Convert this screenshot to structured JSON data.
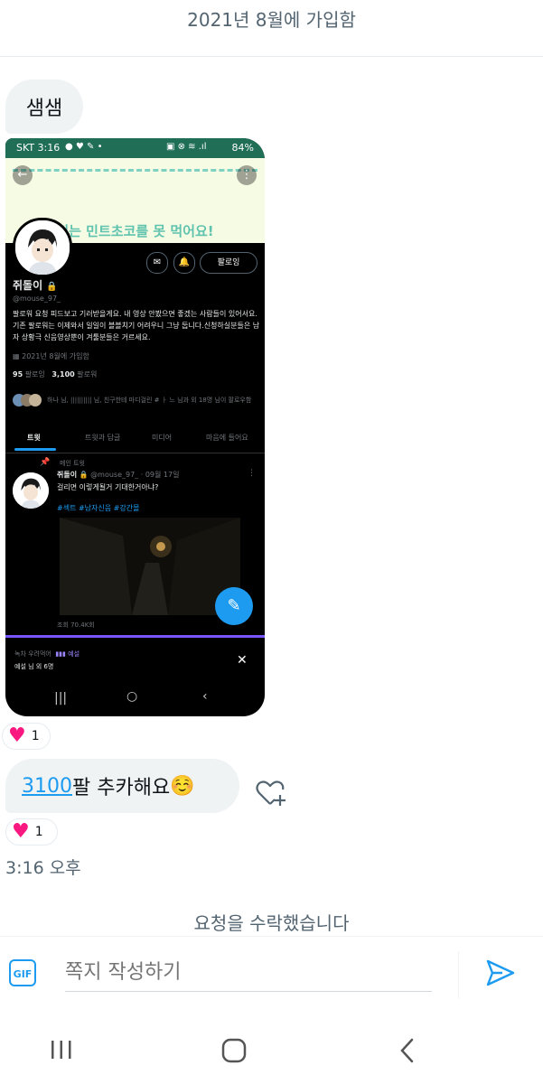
{
  "conversation": {
    "joined_text": "2021년 8월에 가입함",
    "message1": "샘샘",
    "message2_link": "3100",
    "message2_rest": "팔 추카해요",
    "message2_emoji": "☺️",
    "reaction1_count": "1",
    "reaction2_count": "1",
    "timestamp": "3:16 오후",
    "accepted_text": "요청을 수락했습니다"
  },
  "composer": {
    "gif_label": "GIF",
    "placeholder": "쪽지 작성하기"
  },
  "screenshot": {
    "status_time": "SKT 3:16",
    "status_battery": "84%",
    "banner_text": "저는 민트초코를 못 먹어요!",
    "follow_button": "팔로잉",
    "name": "쥐돌이",
    "handle": "@mouse_97_",
    "bio": "팔로워 요청 피드보고 기러받을게요. 내 영상 안봤으면 좋겠는 사람들이 있어서요. 기존 팔로워는 이제와서 일일이 블블치기 어려우니 그냥 둡니다.신청하실분들은 남자 상황극 신음영상뿐이 겨툴분들은 거르세요.",
    "joined": "2021년 8월에 가입함",
    "following_count": "95",
    "following_label": "팔로잉",
    "followers_count": "3,100",
    "followers_label": "팔로워",
    "followed_by": "하나 님, |||||||||| 님, 친구한테 마디걸린 # ㅏ 느 님과 외 18명 님이 팔로우함",
    "tabs": [
      "트윗",
      "트윗과 답글",
      "미디어",
      "마음에 들어요"
    ],
    "pinned_label": "메인 트윗",
    "tweet_author": "쥐돌이",
    "tweet_handle_date": "@mouse_97_ · 09월 17일",
    "tweet_text": "걸리면 이렇게될거 기대한거아냐?",
    "hashtags": "#섹트 #남자신음 #강간몰",
    "views": "조회 70.4K회",
    "space_title": "녹차 우려먹어",
    "space_host": "예설",
    "space_sub": "예설 님 외 6명"
  },
  "colors": {
    "accent": "#1d9bf0",
    "heart": "#f91880",
    "bubble": "#eff3f4",
    "status_bar": "#1f6e55",
    "banner": "#f6fbe4",
    "space_purple": "#7856ff"
  }
}
